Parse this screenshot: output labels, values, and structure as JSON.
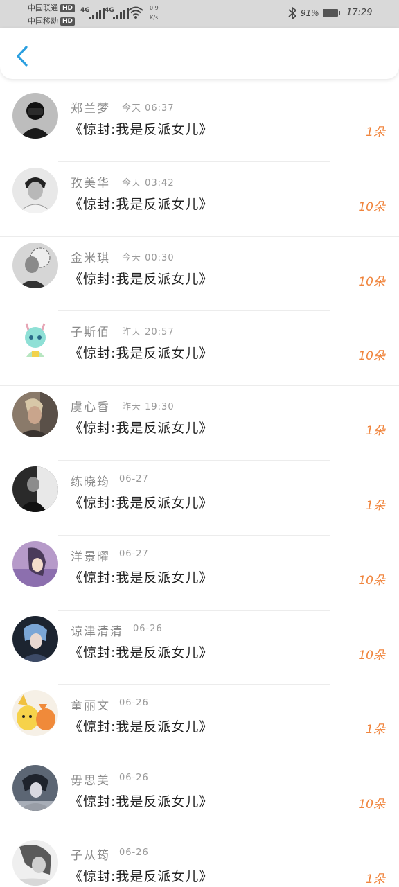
{
  "status_bar": {
    "carrier1": "中国联通",
    "carrier2": "中国移动",
    "hd": "HD",
    "net1": "4G",
    "net2": "4G",
    "speed_value": "0.9",
    "speed_unit": "K/s",
    "battery": "91%",
    "time": "17:29"
  },
  "header": {
    "back_icon": "chevron-left-icon"
  },
  "accent_color": "#f0843c",
  "items": [
    {
      "name": "郑兰梦",
      "time": "今天 06:37",
      "title": "《惊封:我是反派女儿》",
      "gift": "1朵"
    },
    {
      "name": "孜美华",
      "time": "今天 03:42",
      "title": "《惊封:我是反派女儿》",
      "gift": "10朵"
    },
    {
      "name": "金米琪",
      "time": "今天 00:30",
      "title": "《惊封:我是反派女儿》",
      "gift": "10朵"
    },
    {
      "name": "子斯佰",
      "time": "昨天 20:57",
      "title": "《惊封:我是反派女儿》",
      "gift": "10朵"
    },
    {
      "name": "虞心香",
      "time": "昨天 19:30",
      "title": "《惊封:我是反派女儿》",
      "gift": "1朵"
    },
    {
      "name": "练晓筠",
      "time": "06-27",
      "title": "《惊封:我是反派女儿》",
      "gift": "1朵"
    },
    {
      "name": "洋景曜",
      "time": "06-27",
      "title": "《惊封:我是反派女儿》",
      "gift": "10朵"
    },
    {
      "name": "谅津清清",
      "time": "06-26",
      "title": "《惊封:我是反派女儿》",
      "gift": "10朵"
    },
    {
      "name": "童丽文",
      "time": "06-26",
      "title": "《惊封:我是反派女儿》",
      "gift": "1朵"
    },
    {
      "name": "毋思美",
      "time": "06-26",
      "title": "《惊封:我是反派女儿》",
      "gift": "10朵"
    },
    {
      "name": "子从筠",
      "time": "06-26",
      "title": "《惊封:我是反派女儿》",
      "gift": "1朵"
    }
  ]
}
